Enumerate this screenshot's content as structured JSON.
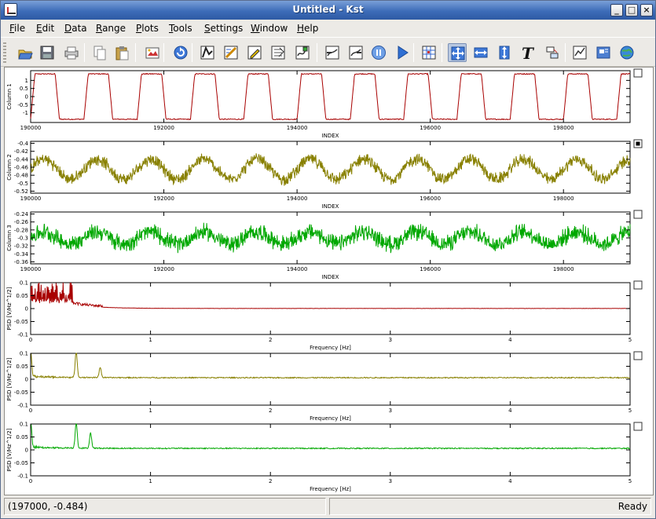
{
  "window": {
    "title": "Untitled - Kst"
  },
  "menu": [
    "File",
    "Edit",
    "Data",
    "Range",
    "Plots",
    "Tools",
    "Settings",
    "Window",
    "Help"
  ],
  "toolbar": {
    "tools": [
      "open-icon",
      "save-icon",
      "print-icon",
      "copy-icon",
      "paste-icon",
      "export-icon",
      "reload-icon",
      "data-wizard-icon",
      "data-manager-icon",
      "edit-vector-icon",
      "view-scalars-icon",
      "view-matrix-icon",
      "back-icon",
      "forward-icon",
      "pause-icon",
      "play-icon",
      "layout-grid-icon",
      "zoom-xy-icon",
      "zoom-x-icon",
      "zoom-y-icon",
      "text-label-icon",
      "arrange-icon",
      "new-plot-icon",
      "change-file-icon",
      "globe-icon"
    ],
    "active": "zoom-xy-icon"
  },
  "colors": {
    "red": "#a80000",
    "olive": "#888000",
    "green": "#00a800"
  },
  "chart_data": [
    {
      "type": "line",
      "xlabel": "INDEX",
      "ylabel": "Column 1",
      "xlim": [
        190000,
        199000
      ],
      "ylim": [
        -1.6,
        1.6
      ],
      "xticks": [
        "190000",
        "192000",
        "194000",
        "196000",
        "198000"
      ],
      "yticks": [
        "1",
        "0.5",
        "0",
        "-0.5",
        "-1"
      ],
      "series": [
        {
          "color": "#a80000",
          "shape": "square-wave",
          "period": 800,
          "amplitude": 1.4,
          "noise": 0.03
        }
      ],
      "checkbox": false
    },
    {
      "type": "line",
      "xlabel": "INDEX",
      "ylabel": "Column 2",
      "xlim": [
        190000,
        199000
      ],
      "ylim": [
        -0.525,
        -0.395
      ],
      "xticks": [
        "190000",
        "192000",
        "194000",
        "196000",
        "198000"
      ],
      "yticks": [
        "-0.4",
        "-0.42",
        "-0.44",
        "-0.46",
        "-0.48",
        "-0.5",
        "-0.52"
      ],
      "series": [
        {
          "color": "#888000",
          "shape": "noisy-sine",
          "period": 800,
          "center": -0.465,
          "amplitude": 0.025,
          "noise": 0.018
        }
      ],
      "checkbox": true
    },
    {
      "type": "line",
      "xlabel": "INDEX",
      "ylabel": "Column 3",
      "xlim": [
        190000,
        199000
      ],
      "ylim": [
        -0.365,
        -0.235
      ],
      "xticks": [
        "190000",
        "192000",
        "194000",
        "196000",
        "198000"
      ],
      "yticks": [
        "-0.24",
        "-0.26",
        "-0.28",
        "-0.3",
        "-0.32",
        "-0.34",
        "-0.36"
      ],
      "series": [
        {
          "color": "#00a800",
          "shape": "noisy-sine",
          "period": 800,
          "center": -0.3,
          "amplitude": 0.015,
          "noise": 0.025
        }
      ],
      "checkbox": false
    },
    {
      "type": "line",
      "xlabel": "Frequency [Hz]",
      "ylabel": "PSD [V/Hz^1/2]",
      "xlim": [
        0,
        5
      ],
      "ylim": [
        -0.1,
        0.1
      ],
      "xticks": [
        "0",
        "1",
        "2",
        "3",
        "4",
        "5"
      ],
      "yticks": [
        "0.1",
        "0.05",
        "0",
        "-0.05",
        "-0.1"
      ],
      "series": [
        {
          "color": "#a80000",
          "shape": "psd-low",
          "peaks": []
        }
      ],
      "checkbox": false
    },
    {
      "type": "line",
      "xlabel": "Frequency [Hz]",
      "ylabel": "PSD [V/Hz^1/2]",
      "xlim": [
        0,
        5
      ],
      "ylim": [
        -0.1,
        0.1
      ],
      "xticks": [
        "0",
        "1",
        "2",
        "3",
        "4",
        "5"
      ],
      "yticks": [
        "0.1",
        "0.05",
        "0",
        "-0.05",
        "-0.1"
      ],
      "series": [
        {
          "color": "#888000",
          "shape": "psd-peaks",
          "peaks": [
            [
              0.0,
              0.1
            ],
            [
              0.38,
              0.1
            ],
            [
              0.58,
              0.04
            ]
          ]
        }
      ],
      "checkbox": false
    },
    {
      "type": "line",
      "xlabel": "Frequency [Hz]",
      "ylabel": "PSD [V/Hz^1/2]",
      "xlim": [
        0,
        5
      ],
      "ylim": [
        -0.1,
        0.1
      ],
      "xticks": [
        "0",
        "1",
        "2",
        "3",
        "4",
        "5"
      ],
      "yticks": [
        "0.1",
        "0.05",
        "0",
        "-0.05",
        "-0.1"
      ],
      "series": [
        {
          "color": "#00a800",
          "shape": "psd-peaks",
          "peaks": [
            [
              0.0,
              0.1
            ],
            [
              0.38,
              0.1
            ],
            [
              0.5,
              0.06
            ]
          ]
        }
      ],
      "checkbox": false
    }
  ],
  "status": {
    "coords": "(197000, -0.484)",
    "state": "Ready"
  }
}
